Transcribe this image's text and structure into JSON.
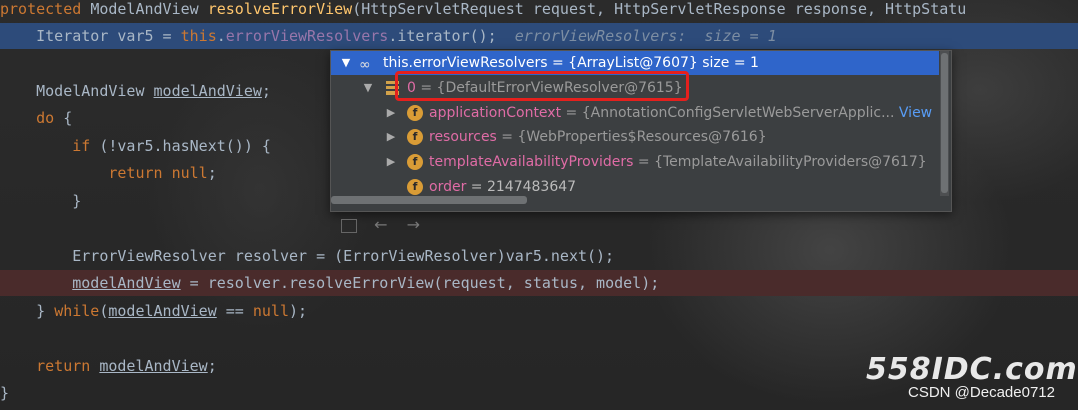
{
  "editor": {
    "line1": {
      "kw": "protected",
      "type": "ModelAndView",
      "method": "resolveErrorView",
      "params": "(HttpServletRequest request, HttpServletResponse response, HttpStatu"
    },
    "line2": {
      "indent": "    ",
      "pre": "Iterator var5 = ",
      "this": "this",
      "dot": ".",
      "field": "errorViewResolvers",
      "post": ".iterator();",
      "hint": "  errorViewResolvers:  size = 1"
    },
    "line4": {
      "indent": "    ",
      "type": "ModelAndView ",
      "var": "modelAndView",
      "post": ";"
    },
    "line5": {
      "indent": "    ",
      "kw": "do",
      "post": " {"
    },
    "line6": {
      "indent": "        ",
      "kw": "if",
      "post": " (!var5.hasNext()) {"
    },
    "line7": {
      "indent": "            ",
      "kw": "return",
      "sp": " ",
      "kw2": "null",
      "post": ";"
    },
    "line8": {
      "text": "        }"
    },
    "line10": {
      "text": "        ErrorViewResolver resolver = (ErrorViewResolver)var5.next();"
    },
    "line11": {
      "indent": "        ",
      "var": "modelAndView",
      "post": " = resolver.resolveErrorView(request, status, model);"
    },
    "line12": {
      "pre": "    } ",
      "kw": "while",
      "paren": "(",
      "var": "modelAndView",
      "mid": " == ",
      "kw2": "null",
      "post": ");"
    },
    "line14": {
      "indent": "    ",
      "kw": "return",
      "sp": " ",
      "var": "modelAndView",
      "post": ";"
    },
    "line15": {
      "text": "}"
    }
  },
  "popup": {
    "header": {
      "name": "this.errorViewResolvers",
      "value": " = {ArrayList@7607}  size = 1"
    },
    "item0": {
      "name": "0",
      "value": " = {DefaultErrorViewResolver@7615}"
    },
    "fields": [
      {
        "name": "applicationContext",
        "value": " = {AnnotationConfigServletWebServerApplic...",
        "link": " View"
      },
      {
        "name": "resources",
        "value": " = {WebProperties$Resources@7616}"
      },
      {
        "name": "templateAvailabilityProviders",
        "value": " = {TemplateAvailabilityProviders@7617}"
      },
      {
        "name": "order",
        "value": " = 2147483647"
      }
    ],
    "field_icon": "f",
    "icons": {
      "header": "watch-glasses-icon",
      "item": "array-element-icon",
      "field": "field-icon",
      "collapse": "chevron-down-icon",
      "expand": "chevron-right-icon"
    }
  },
  "watermark": {
    "brand": "558IDC.com",
    "author": "CSDN @Decade0712"
  },
  "colors": {
    "highlight": "#2f65ca",
    "annotation": "#e5201d",
    "exec_line": "#2d4b7a"
  }
}
